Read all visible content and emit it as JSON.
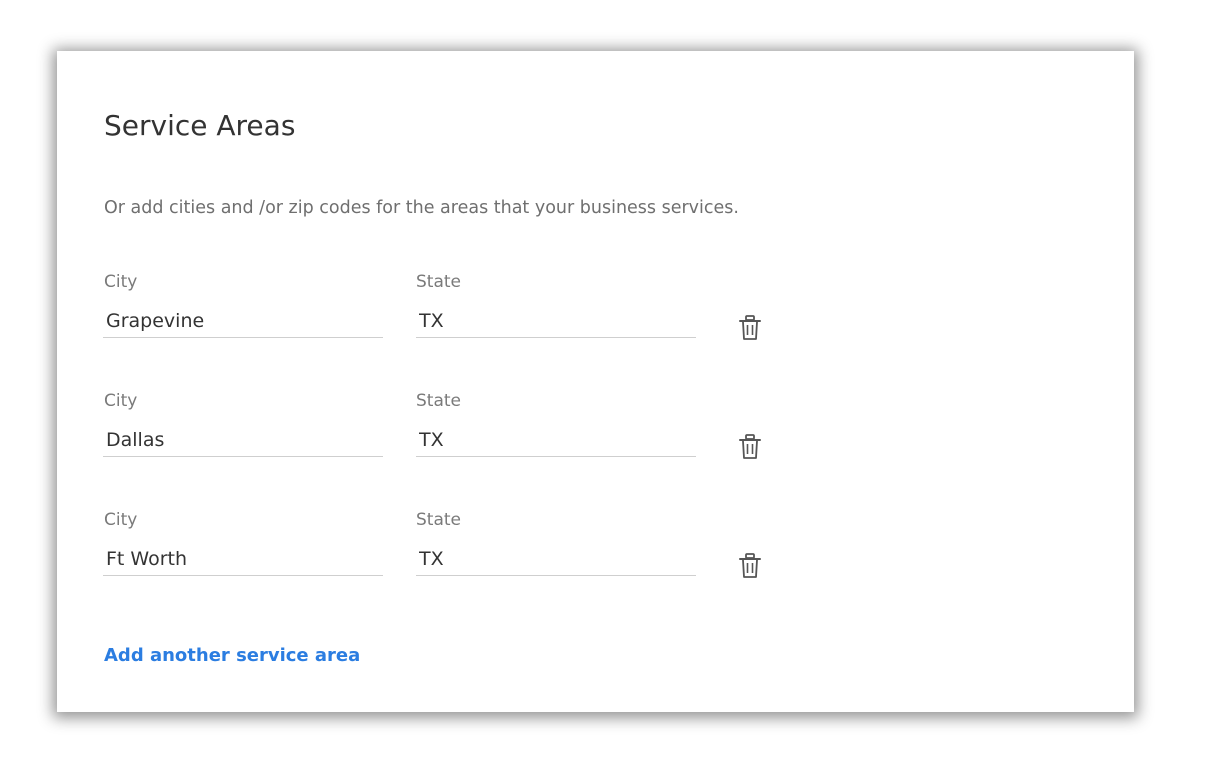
{
  "card": {
    "title": "Service Areas",
    "subtitle": "Or add cities and /or zip codes for the areas that your business services."
  },
  "service_areas": [
    {
      "city_label": "City",
      "city": "Grapevine",
      "state_label": "State",
      "state": "TX",
      "delete_icon": "trash-icon"
    },
    {
      "city_label": "City",
      "city": "Dallas",
      "state_label": "State",
      "state": "TX",
      "delete_icon": "trash-icon"
    },
    {
      "city_label": "City",
      "city": "Ft Worth",
      "state_label": "State",
      "state": "TX",
      "delete_icon": "trash-icon"
    }
  ],
  "add_link": "Add another service area",
  "colors": {
    "link": "#2b7de1",
    "text": "#333333",
    "muted": "#6f6f6f",
    "underline": "#cfcfcf"
  }
}
